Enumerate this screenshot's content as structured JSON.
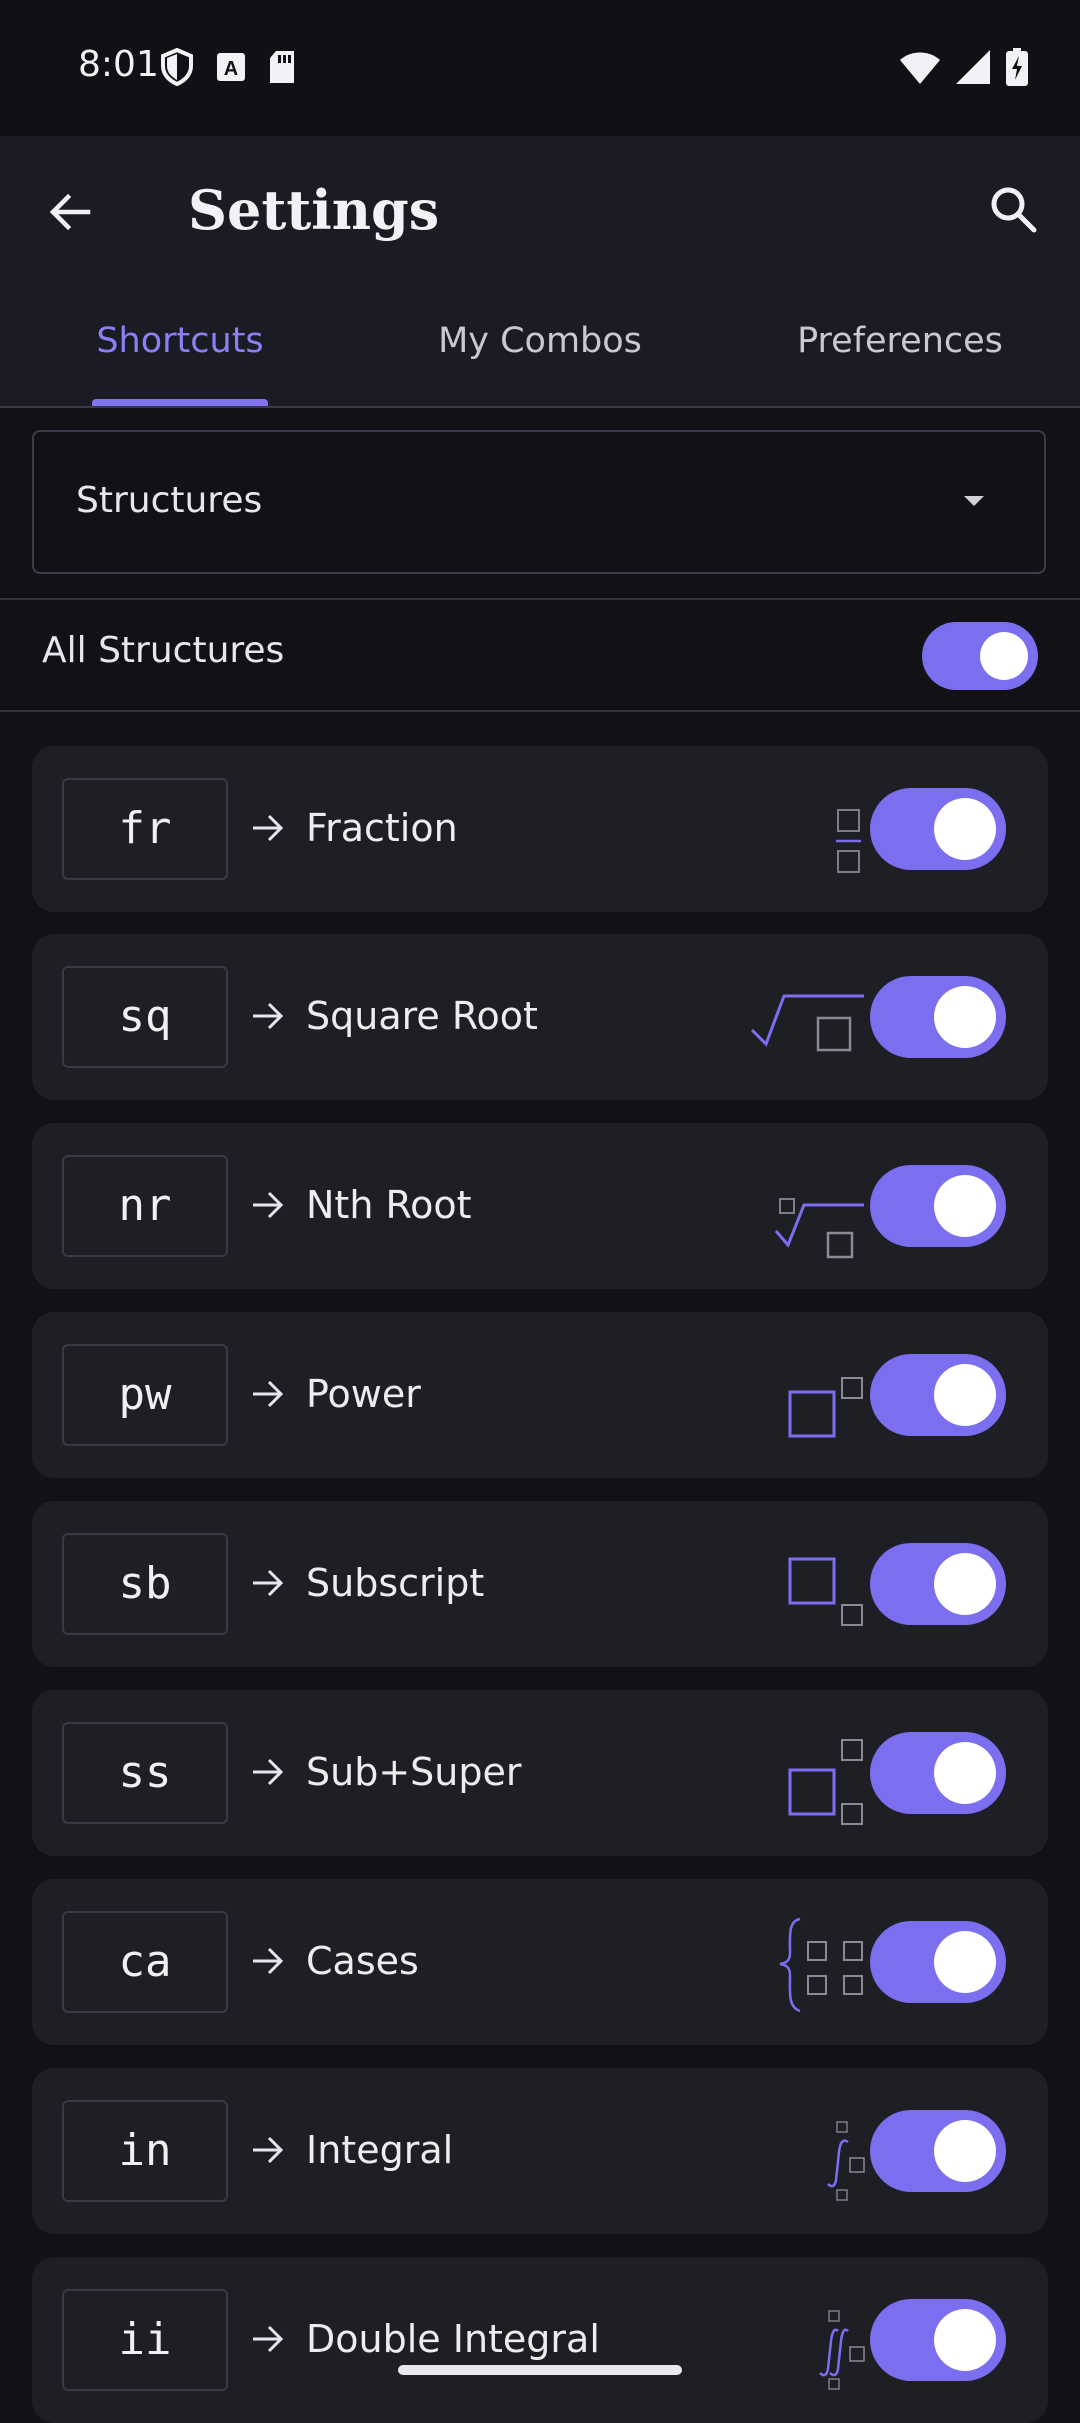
{
  "status_bar": {
    "time": "8:01"
  },
  "header": {
    "title": "Settings"
  },
  "tabs": [
    {
      "label": "Shortcuts",
      "active": true
    },
    {
      "label": "My Combos",
      "active": false
    },
    {
      "label": "Preferences",
      "active": false
    }
  ],
  "filter": {
    "selected": "Structures"
  },
  "all_toggle": {
    "label": "All Structures",
    "on": true
  },
  "shortcuts": [
    {
      "code": "fr",
      "label": "Fraction",
      "preview": "fraction",
      "on": true
    },
    {
      "code": "sq",
      "label": "Square Root",
      "preview": "sqrt",
      "on": true
    },
    {
      "code": "nr",
      "label": "Nth Root",
      "preview": "nthroot",
      "on": true
    },
    {
      "code": "pw",
      "label": "Power",
      "preview": "power",
      "on": true
    },
    {
      "code": "sb",
      "label": "Subscript",
      "preview": "subscript",
      "on": true
    },
    {
      "code": "ss",
      "label": "Sub+Super",
      "preview": "subsuper",
      "on": true
    },
    {
      "code": "ca",
      "label": "Cases",
      "preview": "cases",
      "on": true
    },
    {
      "code": "in",
      "label": "Integral",
      "preview": "integral",
      "on": true
    },
    {
      "code": "ii",
      "label": "Double Integral",
      "preview": "double-integral",
      "on": true
    }
  ],
  "colors": {
    "accent": "#7b6ff0",
    "card": "#1e1e25",
    "background": "#111116"
  }
}
